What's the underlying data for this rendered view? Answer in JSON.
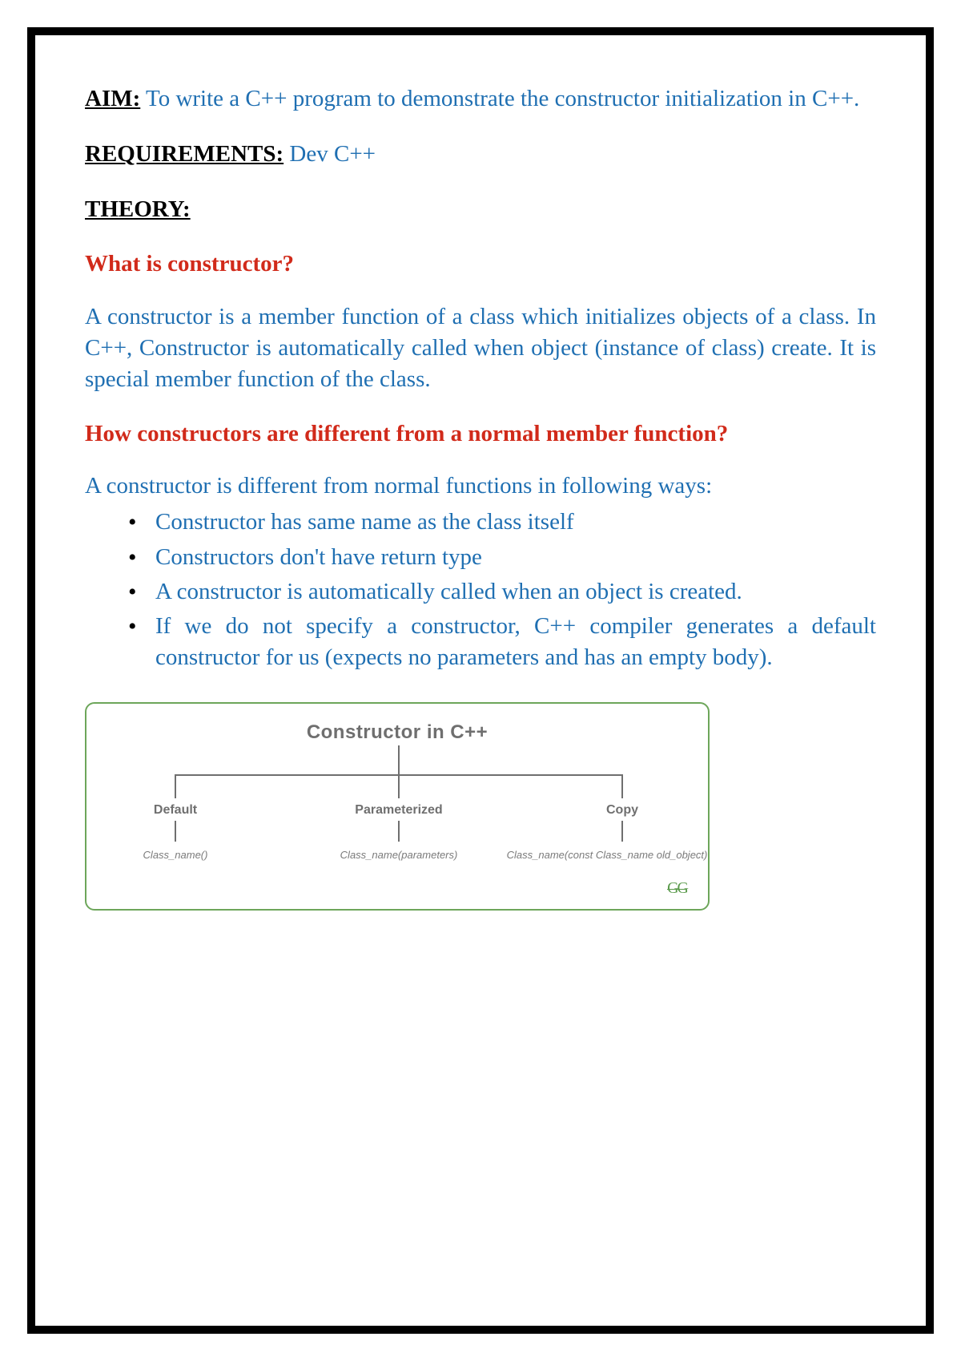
{
  "aim": {
    "label": "AIM:",
    "text": " To write a C++ program to demonstrate the constructor initialization in C++."
  },
  "requirements": {
    "label": "REQUIREMENTS:",
    "text": " Dev C++"
  },
  "theory": {
    "label": "THEORY:"
  },
  "q1": {
    "heading": "What is constructor?",
    "para": "A constructor is a member function of a class which initializes objects of a class. In C++, Constructor is automatically called when object (instance of class) create. It is special member function of the class."
  },
  "q2": {
    "heading": "How constructors are different from a normal member function?",
    "intro": "A constructor is different from normal functions in following ways:",
    "bullets": [
      " Constructor has same name as the class itself",
      " Constructors don't have return type",
      " A constructor is automatically called when an object is created.",
      " If we do not specify a constructor, C++ compiler generates a default constructor for us (expects no parameters and has an empty body)."
    ]
  },
  "diagram": {
    "title": "Constructor in C++",
    "branches": [
      {
        "label": "Default",
        "sub": "Class_name()"
      },
      {
        "label": "Parameterized",
        "sub": "Class_name(parameters)"
      },
      {
        "label": "Copy",
        "sub": "Class_name(const Class_name old_object)"
      }
    ],
    "watermark": "GG"
  }
}
